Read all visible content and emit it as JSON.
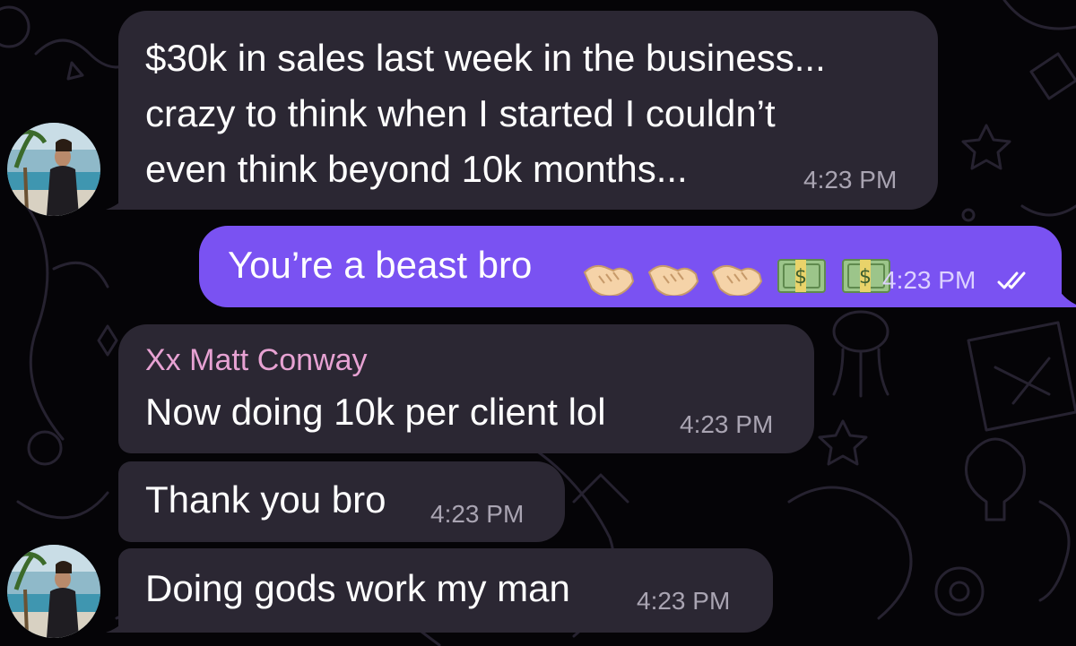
{
  "messages": [
    {
      "lines": [
        "$30k in sales last week in the business...",
        "crazy to think when I started I couldn’t",
        "even think beyond 10k months..."
      ],
      "time": "4:23 PM",
      "direction": "incoming"
    },
    {
      "text": "You’re a beast bro",
      "emojis": [
        "handshake-emoji",
        "handshake-emoji",
        "handshake-emoji",
        "money-emoji",
        "money-emoji"
      ],
      "time": "4:23 PM",
      "direction": "outgoing",
      "status": "read"
    },
    {
      "sender": "Xx Matt Conway",
      "text": "Now doing 10k per client lol",
      "time": "4:23 PM",
      "direction": "incoming"
    },
    {
      "text": "Thank you bro",
      "time": "4:23 PM",
      "direction": "incoming"
    },
    {
      "text": "Doing gods work my man",
      "time": "4:23 PM",
      "direction": "incoming"
    }
  ],
  "colors": {
    "background": "#050407",
    "incoming_bubble": "#2b2733",
    "outgoing_bubble": "#7a52f2",
    "sender_name": "#e7a2d3"
  }
}
